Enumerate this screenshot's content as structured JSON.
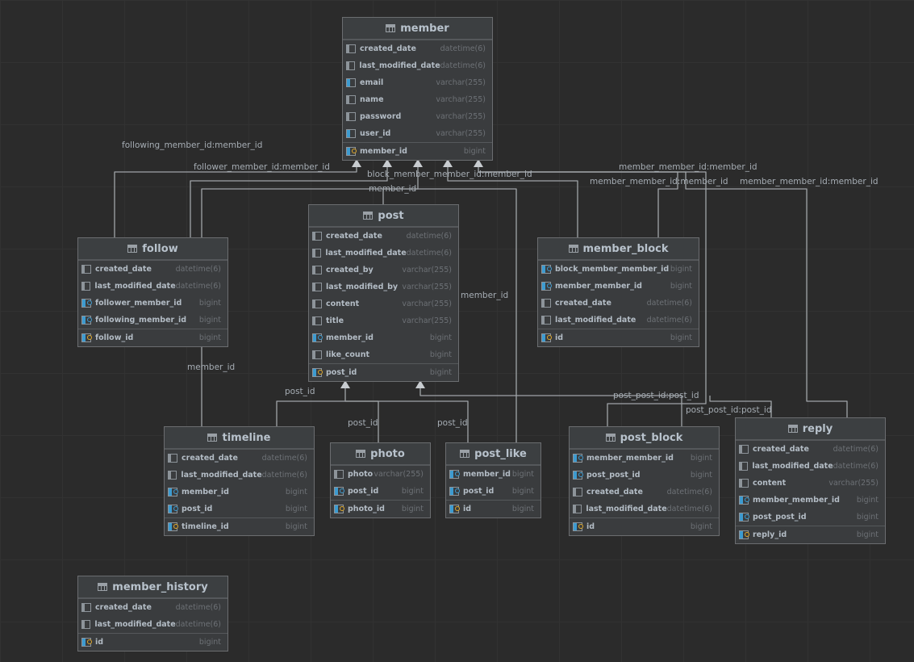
{
  "tables": [
    {
      "name": "member",
      "icon": "table-icon",
      "columns": [
        {
          "name": "created_date",
          "type": "datetime(6)",
          "kind": "col"
        },
        {
          "name": "last_modified_date",
          "type": "datetime(6)",
          "kind": "col"
        },
        {
          "name": "email",
          "type": "varchar(255)",
          "kind": "unique"
        },
        {
          "name": "name",
          "type": "varchar(255)",
          "kind": "col"
        },
        {
          "name": "password",
          "type": "varchar(255)",
          "kind": "col"
        },
        {
          "name": "user_id",
          "type": "varchar(255)",
          "kind": "unique"
        },
        {
          "name": "member_id",
          "type": "bigint",
          "kind": "pk"
        }
      ]
    },
    {
      "name": "follow",
      "icon": "table-icon",
      "columns": [
        {
          "name": "created_date",
          "type": "datetime(6)",
          "kind": "col"
        },
        {
          "name": "last_modified_date",
          "type": "datetime(6)",
          "kind": "col"
        },
        {
          "name": "follower_member_id",
          "type": "bigint",
          "kind": "fk"
        },
        {
          "name": "following_member_id",
          "type": "bigint",
          "kind": "fk"
        },
        {
          "name": "follow_id",
          "type": "bigint",
          "kind": "pk"
        }
      ]
    },
    {
      "name": "post",
      "icon": "table-icon",
      "columns": [
        {
          "name": "created_date",
          "type": "datetime(6)",
          "kind": "col"
        },
        {
          "name": "last_modified_date",
          "type": "datetime(6)",
          "kind": "col"
        },
        {
          "name": "created_by",
          "type": "varchar(255)",
          "kind": "col"
        },
        {
          "name": "last_modified_by",
          "type": "varchar(255)",
          "kind": "col"
        },
        {
          "name": "content",
          "type": "varchar(255)",
          "kind": "col"
        },
        {
          "name": "title",
          "type": "varchar(255)",
          "kind": "col"
        },
        {
          "name": "member_id",
          "type": "bigint",
          "kind": "fk"
        },
        {
          "name": "like_count",
          "type": "bigint",
          "kind": "col"
        },
        {
          "name": "post_id",
          "type": "bigint",
          "kind": "pk"
        }
      ]
    },
    {
      "name": "member_block",
      "icon": "table-icon",
      "columns": [
        {
          "name": "block_member_member_id",
          "type": "bigint",
          "kind": "fk"
        },
        {
          "name": "member_member_id",
          "type": "bigint",
          "kind": "fk"
        },
        {
          "name": "created_date",
          "type": "datetime(6)",
          "kind": "col"
        },
        {
          "name": "last_modified_date",
          "type": "datetime(6)",
          "kind": "col"
        },
        {
          "name": "id",
          "type": "bigint",
          "kind": "pk"
        }
      ]
    },
    {
      "name": "timeline",
      "icon": "table-icon",
      "columns": [
        {
          "name": "created_date",
          "type": "datetime(6)",
          "kind": "col"
        },
        {
          "name": "last_modified_date",
          "type": "datetime(6)",
          "kind": "col"
        },
        {
          "name": "member_id",
          "type": "bigint",
          "kind": "fk"
        },
        {
          "name": "post_id",
          "type": "bigint",
          "kind": "fk"
        },
        {
          "name": "timeline_id",
          "type": "bigint",
          "kind": "pk"
        }
      ]
    },
    {
      "name": "photo",
      "icon": "table-icon",
      "columns": [
        {
          "name": "photo",
          "type": "varchar(255)",
          "kind": "col"
        },
        {
          "name": "post_id",
          "type": "bigint",
          "kind": "fk"
        },
        {
          "name": "photo_id",
          "type": "bigint",
          "kind": "pk"
        }
      ]
    },
    {
      "name": "post_like",
      "icon": "table-icon",
      "columns": [
        {
          "name": "member_id",
          "type": "bigint",
          "kind": "fk"
        },
        {
          "name": "post_id",
          "type": "bigint",
          "kind": "fk"
        },
        {
          "name": "id",
          "type": "bigint",
          "kind": "pk"
        }
      ]
    },
    {
      "name": "post_block",
      "icon": "table-icon",
      "columns": [
        {
          "name": "member_member_id",
          "type": "bigint",
          "kind": "fk"
        },
        {
          "name": "post_post_id",
          "type": "bigint",
          "kind": "fk"
        },
        {
          "name": "created_date",
          "type": "datetime(6)",
          "kind": "col"
        },
        {
          "name": "last_modified_date",
          "type": "datetime(6)",
          "kind": "col"
        },
        {
          "name": "id",
          "type": "bigint",
          "kind": "pk"
        }
      ]
    },
    {
      "name": "reply",
      "icon": "table-icon",
      "columns": [
        {
          "name": "created_date",
          "type": "datetime(6)",
          "kind": "col"
        },
        {
          "name": "last_modified_date",
          "type": "datetime(6)",
          "kind": "col"
        },
        {
          "name": "content",
          "type": "varchar(255)",
          "kind": "col"
        },
        {
          "name": "member_member_id",
          "type": "bigint",
          "kind": "fk"
        },
        {
          "name": "post_post_id",
          "type": "bigint",
          "kind": "fk"
        },
        {
          "name": "reply_id",
          "type": "bigint",
          "kind": "pk"
        }
      ]
    },
    {
      "name": "member_history",
      "icon": "table-icon",
      "columns": [
        {
          "name": "created_date",
          "type": "datetime(6)",
          "kind": "col"
        },
        {
          "name": "last_modified_date",
          "type": "datetime(6)",
          "kind": "col"
        },
        {
          "name": "id",
          "type": "bigint",
          "kind": "pk"
        }
      ]
    }
  ],
  "relations": [
    {
      "from": "follow",
      "to": "member",
      "label": "following_member_id:member_id"
    },
    {
      "from": "follow",
      "to": "member",
      "label": "follower_member_id:member_id"
    },
    {
      "from": "timeline",
      "to": "member",
      "label": "member_id"
    },
    {
      "from": "post",
      "to": "member",
      "label": "member_id"
    },
    {
      "from": "post_like",
      "to": "member",
      "label": "member_id"
    },
    {
      "from": "member_block",
      "to": "member",
      "label": "block_member_member_id:member_id"
    },
    {
      "from": "member_block",
      "to": "member",
      "label": "member_member_id:member_id"
    },
    {
      "from": "post_block",
      "to": "member",
      "label": "member_member_id:member_id"
    },
    {
      "from": "reply",
      "to": "member",
      "label": "member_member_id:member_id"
    },
    {
      "from": "timeline",
      "to": "post",
      "label": "post_id"
    },
    {
      "from": "photo",
      "to": "post",
      "label": "post_id"
    },
    {
      "from": "post_like",
      "to": "post",
      "label": "post_id"
    },
    {
      "from": "post_block",
      "to": "post",
      "label": "post_post_id:post_id"
    },
    {
      "from": "reply",
      "to": "post",
      "label": "post_post_id:post_id"
    }
  ]
}
